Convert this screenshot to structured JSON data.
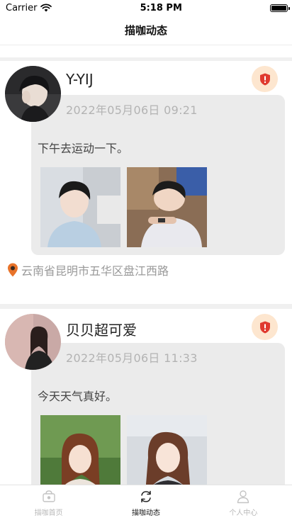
{
  "status_bar": {
    "carrier": "Carrier",
    "time": "5:18 PM"
  },
  "nav": {
    "title": "描咖动态"
  },
  "posts": [
    {
      "username": "Y-YIJ",
      "timestamp": "2022年05月06日  09:21",
      "text": "下午去运动一下。",
      "location": "云南省昆明市五华区盘江西路"
    },
    {
      "username": "贝贝超可爱",
      "timestamp": "2022年05月06日  11:33",
      "text": "今天天气真好。"
    }
  ],
  "tabs": [
    {
      "label": "描咖首页",
      "icon": "home-cup-icon",
      "active": false
    },
    {
      "label": "描咖动态",
      "icon": "refresh-feed-icon",
      "active": true
    },
    {
      "label": "个人中心",
      "icon": "person-icon",
      "active": false
    }
  ],
  "colors": {
    "report_bg": "#fde6cf",
    "report_icon": "#e03a2f",
    "location_icon": "#e8732a"
  }
}
